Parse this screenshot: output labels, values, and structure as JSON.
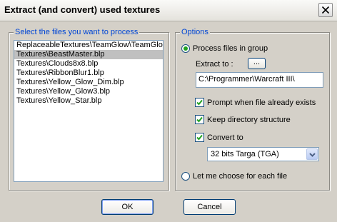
{
  "window": {
    "title": "Extract (and convert) used textures",
    "close_icon": "close-icon"
  },
  "files_group": {
    "legend": "Select the files you want to process",
    "items": [
      "ReplaceableTextures\\TeamGlow\\TeamGlo",
      "Textures\\BeastMaster.blp",
      "Textures\\Clouds8x8.blp",
      "Textures\\RibbonBlur1.blp",
      "Textures\\Yellow_Glow_Dim.blp",
      "Textures\\Yellow_Glow3.blp",
      "Textures\\Yellow_Star.blp"
    ],
    "selected_index": 1
  },
  "options_group": {
    "legend": "Options",
    "process_in_group_label": "Process files in group",
    "process_in_group_selected": true,
    "extract_to_label": "Extract to :",
    "browse_label": "...",
    "extract_path": "C:\\Programmer\\Warcraft III\\",
    "prompt_label": "Prompt when file already exists",
    "prompt_checked": true,
    "keep_dir_label": "Keep directory structure",
    "keep_dir_checked": true,
    "convert_label": "Convert to",
    "convert_checked": true,
    "convert_format": "32 bits Targa (TGA)",
    "choose_each_label": "Let me choose for each file",
    "choose_each_selected": false
  },
  "buttons": {
    "ok": "OK",
    "cancel": "Cancel"
  }
}
